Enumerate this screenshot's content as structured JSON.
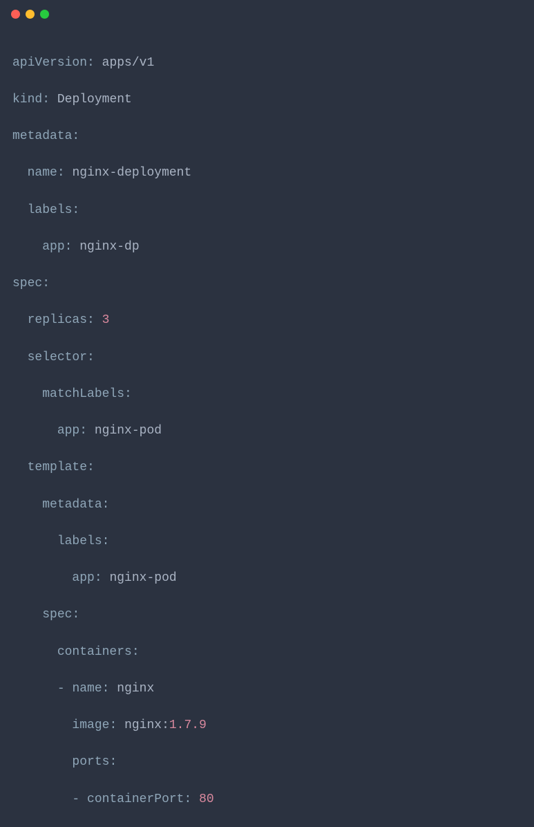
{
  "code": {
    "l1": {
      "key": "apiVersion",
      "val": "apps/v1"
    },
    "l2": {
      "key": "kind",
      "val": "Deployment"
    },
    "l3": {
      "key": "metadata"
    },
    "l4": {
      "key": "name",
      "val": "nginx-deployment"
    },
    "l5": {
      "key": "labels"
    },
    "l6": {
      "key": "app",
      "val": "nginx-dp"
    },
    "l7": {
      "key": "spec"
    },
    "l8": {
      "key": "replicas",
      "val": "3"
    },
    "l9": {
      "key": "selector"
    },
    "l10": {
      "key": "matchLabels"
    },
    "l11": {
      "key": "app",
      "val": "nginx-pod"
    },
    "l12": {
      "key": "template"
    },
    "l13": {
      "key": "metadata"
    },
    "l14": {
      "key": "labels"
    },
    "l15": {
      "key": "app",
      "val": "nginx-pod"
    },
    "l16": {
      "key": "spec"
    },
    "l17": {
      "key": "containers"
    },
    "l18": {
      "key": "name",
      "val": "nginx"
    },
    "l19": {
      "key": "image",
      "val_a": "nginx:",
      "val_b": "1.7.9"
    },
    "l20": {
      "key": "ports"
    },
    "l21": {
      "key": "containerPort",
      "val": "80"
    }
  }
}
